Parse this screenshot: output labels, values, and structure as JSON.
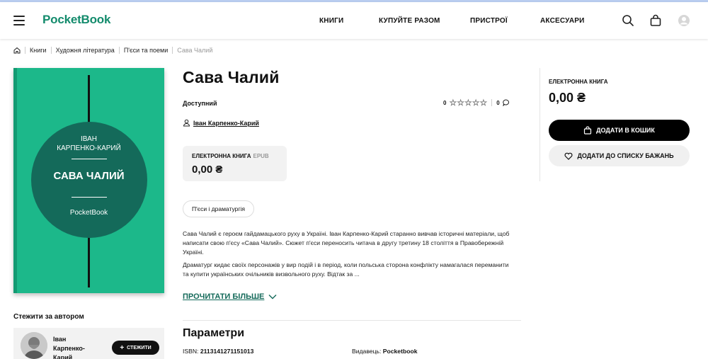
{
  "header": {
    "logo": "PocketBook",
    "nav": [
      "КНИГИ",
      "КУПУЙТЕ РАЗОМ",
      "ПРИСТРОЇ",
      "АКСЕСУАРИ"
    ]
  },
  "breadcrumb": [
    "Книги",
    "Художня література",
    "П'єси та поеми",
    "Сава Чалий"
  ],
  "cover": {
    "author_line1": "ІВАН",
    "author_line2": "КАРПЕНКО-КАРИЙ",
    "title": "САВА ЧАЛИЙ",
    "publisher": "PocketBook",
    "color": "#1cb88a"
  },
  "book": {
    "title": "Сава Чалий",
    "availability": "Доступний",
    "rating": "0",
    "reviews": "0",
    "author": "Іван Карпенко-Карий",
    "genre": "П'єси і драматургія",
    "description": [
      "Сава Чалий є героєм гайдамацького руху в Україні. Іван Карпенко-Карий старанно вивчав історичні матеріали, щоб написати свою п'єсу «Сава Чалий». Сюжет п'єси переносить читача в другу третину 18 століття в Правобережній Україні.",
      "Драматург кидає своїх персонажів у вир подій і в період, коли польська сторона конфлікту намагалася переманити та купити українських очільників визвольного руху. Відтак за ..."
    ],
    "read_more": "ПРОЧИТАТИ БІЛЬШЕ"
  },
  "format": {
    "label": "ЕЛЕКТРОННА КНИГА",
    "type": "EPUB",
    "price": "0,00 ₴"
  },
  "sidebar": {
    "label": "ЕЛЕКТРОННА КНИГА",
    "price": "0,00 ₴",
    "add_to_cart": "ДОДАТИ В КОШИК",
    "add_to_wishlist": "ДОДАТИ ДО СПИСКУ БАЖАНЬ"
  },
  "follow": {
    "title": "Стежити за автором",
    "author_name": "Іван Карпенко-Карий",
    "button": "СТЕЖИТИ"
  },
  "params": {
    "title": "Параметри",
    "isbn_label": "ISBN:",
    "isbn": "2113141271151013",
    "publisher_label": "Видавець:",
    "publisher": "Pocketbook"
  },
  "colors": {
    "brand": "#138b6c",
    "accent_dark": "#146a5a",
    "button": "#000000"
  }
}
